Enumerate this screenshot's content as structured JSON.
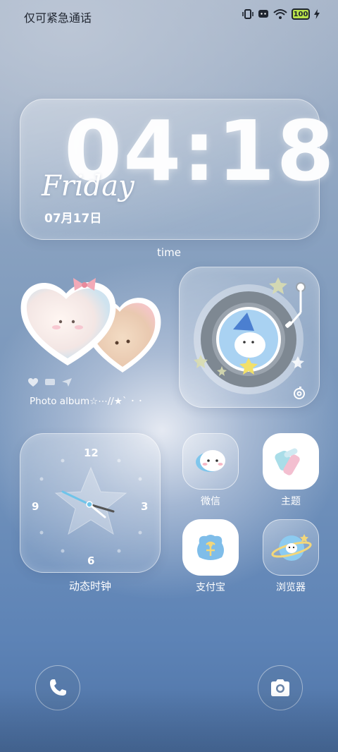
{
  "status_bar": {
    "carrier_text": "仅可紧急通话",
    "battery": "100"
  },
  "clock_widget": {
    "time": "04:18",
    "day": "Friday",
    "date": "07月17日",
    "label": "time"
  },
  "photo_widget": {
    "caption": "Photo album☆⋯//★ˋ ･ ･"
  },
  "analog_clock": {
    "numbers": {
      "n12": "12",
      "n3": "3",
      "n6": "6",
      "n9": "9"
    },
    "label": "动态时钟"
  },
  "apps": [
    {
      "label": "微信",
      "icon": "wechat-icon"
    },
    {
      "label": "主题",
      "icon": "theme-icon"
    },
    {
      "label": "支付宝",
      "icon": "alipay-icon"
    },
    {
      "label": "浏览器",
      "icon": "browser-icon"
    }
  ],
  "dock": {
    "phone_icon": "phone-icon",
    "camera_icon": "camera-icon"
  },
  "colors": {
    "battery": "#b9e24a",
    "heart_pink": "#f6b8c6",
    "accent_blue": "#6fa6e8"
  }
}
